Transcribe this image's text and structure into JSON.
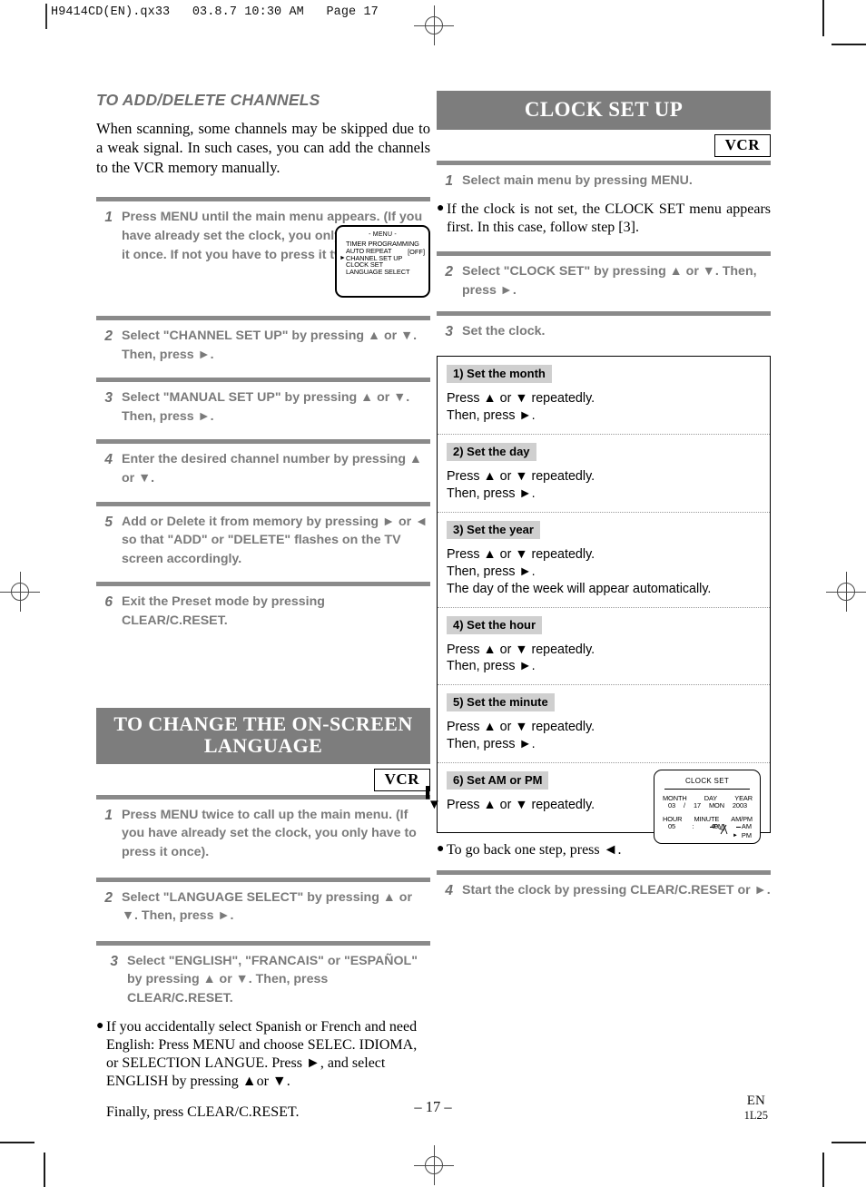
{
  "slug": {
    "text": "H9414CD(EN).qx33   03.8.7 10:30 AM   Page 17"
  },
  "left_column": {
    "section1": {
      "heading": "TO ADD/DELETE CHANNELS",
      "intro": "When scanning, some channels may be skipped due to a weak signal. In such cases, you can add  the channels to the VCR memory manually.",
      "steps": [
        {
          "num": "1",
          "text": "Press MENU until the main menu appears. (If you have already set the clock, you only have to press it once.  If not you have to press it twice)."
        },
        {
          "num": "2",
          "text": "Select \"CHANNEL SET UP\" by pressing ▲ or ▼. Then, press ►."
        },
        {
          "num": "3",
          "text": "Select \"MANUAL SET UP\" by pressing ▲ or ▼. Then, press ►."
        },
        {
          "num": "4",
          "text": "Enter the desired channel number by pressing ▲ or ▼."
        },
        {
          "num": "5",
          "text": "Add or Delete it from memory by pressing ► or ◄ so that \"ADD\" or \"DELETE\" flashes on the TV screen accordingly."
        },
        {
          "num": "6",
          "text": "Exit the Preset mode by pressing CLEAR/C.RESET."
        }
      ],
      "osd_menu": {
        "title": "- MENU -",
        "items": [
          "TIMER PROGRAMMING",
          "AUTO REPEAT",
          "CHANNEL SET UP",
          "CLOCK SET",
          "LANGUAGE SELECT"
        ],
        "auto_repeat_value": "[OFF]",
        "cursor": "►",
        "cursor_on_item": "CHANNEL SET UP"
      }
    },
    "section2": {
      "heading_line1": "TO CHANGE THE ON-SCREEN",
      "heading_line2": "LANGUAGE",
      "badge": "VCR",
      "steps": [
        {
          "num": "1",
          "text": "Press MENU twice to call up the main menu. (If you have already set the clock, you only have to press it once)."
        },
        {
          "num": "2",
          "text": "Select \"LANGUAGE SELECT\" by pressing ▲ or ▼. Then, press ►."
        },
        {
          "num": "3",
          "text": "Select \"ENGLISH\", \"FRANCAIS\" or \"ESPAÑOL\" by pressing ▲ or ▼. Then, press CLEAR/C.RESET."
        }
      ],
      "note": "If you accidentally select Spanish or French and need English: Press MENU and choose SELEC. IDIOMA, or SELECTION LANGUE. Press ►, and select ENGLISH by pressing ▲or ▼.",
      "note_final": "Finally, press CLEAR/C.RESET."
    }
  },
  "right_column": {
    "heading": "CLOCK SET UP",
    "badge": "VCR",
    "steps_top": [
      {
        "num": "1",
        "text": "Select main menu by pressing MENU."
      }
    ],
    "note_top": "If the clock is not set, the CLOCK SET menu appears first. In this case, follow step [3].",
    "steps_mid": [
      {
        "num": "2",
        "text": "Select \"CLOCK SET\" by pressing ▲ or ▼. Then, press ►."
      },
      {
        "num": "3",
        "text": "Set the clock."
      }
    ],
    "clock_sections": [
      {
        "label": "1) Set the month",
        "lines": [
          "Press ▲ or ▼ repeatedly.",
          "Then, press ►."
        ]
      },
      {
        "label": "2) Set the day",
        "lines": [
          "Press ▲ or ▼ repeatedly.",
          "Then, press ►."
        ]
      },
      {
        "label": "3) Set the year",
        "lines": [
          "Press ▲ or ▼ repeatedly.",
          "Then, press ►.",
          "The day of the week will appear automatically."
        ]
      },
      {
        "label": "4) Set the hour",
        "lines": [
          "Press ▲ or ▼ repeatedly.",
          "Then, press ►."
        ]
      },
      {
        "label": "5) Set the minute",
        "lines": [
          "Press ▲ or ▼ repeatedly.",
          "Then, press ►."
        ]
      },
      {
        "label": "6) Set AM or PM",
        "lines": [
          "Press  ▲ or ▼ repeatedly."
        ]
      }
    ],
    "osd_clock": {
      "title": "CLOCK SET",
      "head_month": "MONTH",
      "head_day": "DAY",
      "head_year": "YEAR",
      "val_month": "03",
      "val_sep1": "/",
      "val_day": "17",
      "val_weekday": "MON",
      "val_year": "2003",
      "head_hour": "HOUR",
      "head_minute": "MINUTE",
      "head_ampm": "AM/PM",
      "val_hour": "05",
      "val_sep2": ":",
      "val_minute": "40",
      "flash_pm": "PM",
      "flash_am": "AM",
      "flash_pm_selected": "PM",
      "flash_cursor": "►"
    },
    "note_bottom": "To go back one step, press ◄.",
    "steps_bottom": [
      {
        "num": "4",
        "text": "Start the clock by pressing CLEAR/C.RESET or ►."
      }
    ]
  },
  "footer": {
    "folio": "– 17 –",
    "lang_code": "EN",
    "doc_code": "1L25"
  },
  "colors": {
    "heading_bar": "#7d7d7d",
    "step_text": "#7a7a7a",
    "rule": "#8a8a8a",
    "label_bg": "#cfcfcf"
  }
}
